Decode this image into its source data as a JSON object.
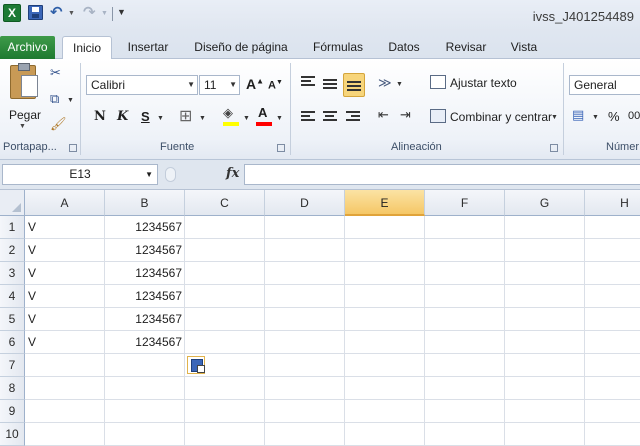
{
  "title_bar": {
    "app_logo": "X",
    "window_title": "ivss_J401254489",
    "icons": [
      "excel-logo-icon",
      "save-icon",
      "undo-icon",
      "redo-icon",
      "customize-toolbar-icon"
    ]
  },
  "tabs": [
    {
      "label": "Archivo",
      "active": false
    },
    {
      "label": "Inicio",
      "active": true
    },
    {
      "label": "Insertar",
      "active": false
    },
    {
      "label": "Diseño de página",
      "active": false
    },
    {
      "label": "Fórmulas",
      "active": false
    },
    {
      "label": "Datos",
      "active": false
    },
    {
      "label": "Revisar",
      "active": false
    },
    {
      "label": "Vista",
      "active": false
    }
  ],
  "ribbon": {
    "clipboard": {
      "paste_label": "Pegar",
      "group_label": "Portapap..."
    },
    "font": {
      "font_name": "Calibri",
      "font_size": "11",
      "grow_label": "A",
      "shrink_label": "A",
      "bold": "N",
      "italic": "K",
      "underline": "S",
      "group_label": "Fuente",
      "highlight_color": "#ffff00",
      "font_color": "#ff0000"
    },
    "alignment": {
      "wrap_label": "Ajustar texto",
      "merge_label": "Combinar y centrar",
      "group_label": "Alineación"
    },
    "number": {
      "format": "General",
      "percent": "%",
      "thousands": "00",
      "group_label": "Númer"
    }
  },
  "formula_bar": {
    "name_box": "E13",
    "fx": "fx",
    "formula": ""
  },
  "grid": {
    "columns": [
      "A",
      "B",
      "C",
      "D",
      "E",
      "F",
      "G",
      "H"
    ],
    "selected_column": "E",
    "rows": [
      {
        "num": "1",
        "a": "V",
        "b": "1234567"
      },
      {
        "num": "2",
        "a": "V",
        "b": "1234567"
      },
      {
        "num": "3",
        "a": "V",
        "b": "1234567"
      },
      {
        "num": "4",
        "a": "V",
        "b": "1234567"
      },
      {
        "num": "5",
        "a": "V",
        "b": "1234567"
      },
      {
        "num": "6",
        "a": "V",
        "b": "1234567"
      },
      {
        "num": "7",
        "a": "",
        "b": ""
      },
      {
        "num": "8",
        "a": "",
        "b": ""
      },
      {
        "num": "9",
        "a": "",
        "b": ""
      },
      {
        "num": "10",
        "a": "",
        "b": ""
      }
    ]
  },
  "colors": {
    "archivo_tab": "#1e7a30",
    "selected_header": "#f5c766"
  }
}
